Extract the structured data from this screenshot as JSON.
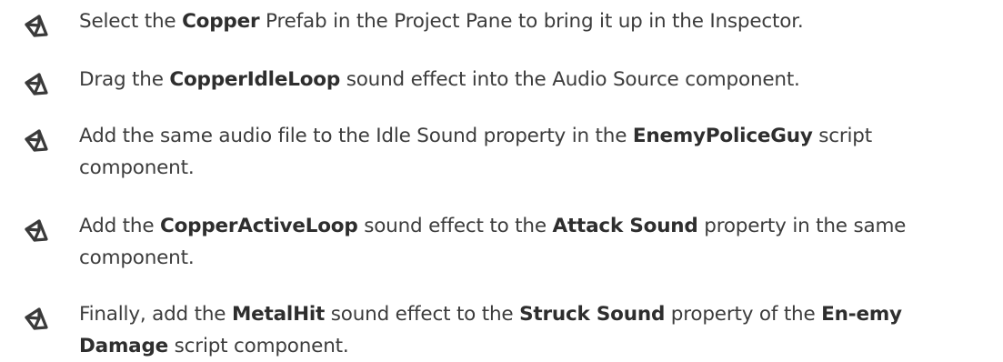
{
  "steps": [
    {
      "icon": "unity-logo-icon",
      "segments": [
        {
          "t": "Select the ",
          "b": false
        },
        {
          "t": "Copper",
          "b": true
        },
        {
          "t": " Prefab in the Project Pane to bring it up in the Inspector.",
          "b": false
        }
      ]
    },
    {
      "icon": "unity-logo-icon",
      "segments": [
        {
          "t": "Drag the ",
          "b": false
        },
        {
          "t": "CopperIdleLoop",
          "b": true
        },
        {
          "t": " sound effect into the Audio Source component.",
          "b": false
        }
      ]
    },
    {
      "icon": "unity-logo-icon",
      "segments": [
        {
          "t": "Add the same audio file to the Idle Sound property in the ",
          "b": false
        },
        {
          "t": "EnemyPoliceGuy",
          "b": true
        },
        {
          "t": " script component.",
          "b": false
        }
      ]
    },
    {
      "icon": "unity-logo-icon",
      "segments": [
        {
          "t": "Add the ",
          "b": false
        },
        {
          "t": "CopperActiveLoop",
          "b": true
        },
        {
          "t": " sound effect to the ",
          "b": false
        },
        {
          "t": "Attack Sound",
          "b": true
        },
        {
          "t": " property in the same component.",
          "b": false
        }
      ]
    },
    {
      "icon": "unity-logo-icon",
      "segments": [
        {
          "t": "Finally, add the ",
          "b": false
        },
        {
          "t": "MetalHit",
          "b": true
        },
        {
          "t": " sound effect to the ",
          "b": false
        },
        {
          "t": "Struck Sound",
          "b": true
        },
        {
          "t": " property of the ",
          "b": false
        },
        {
          "t": "En-emy Damage",
          "b": true
        },
        {
          "t": " script component.",
          "b": false
        }
      ]
    }
  ]
}
